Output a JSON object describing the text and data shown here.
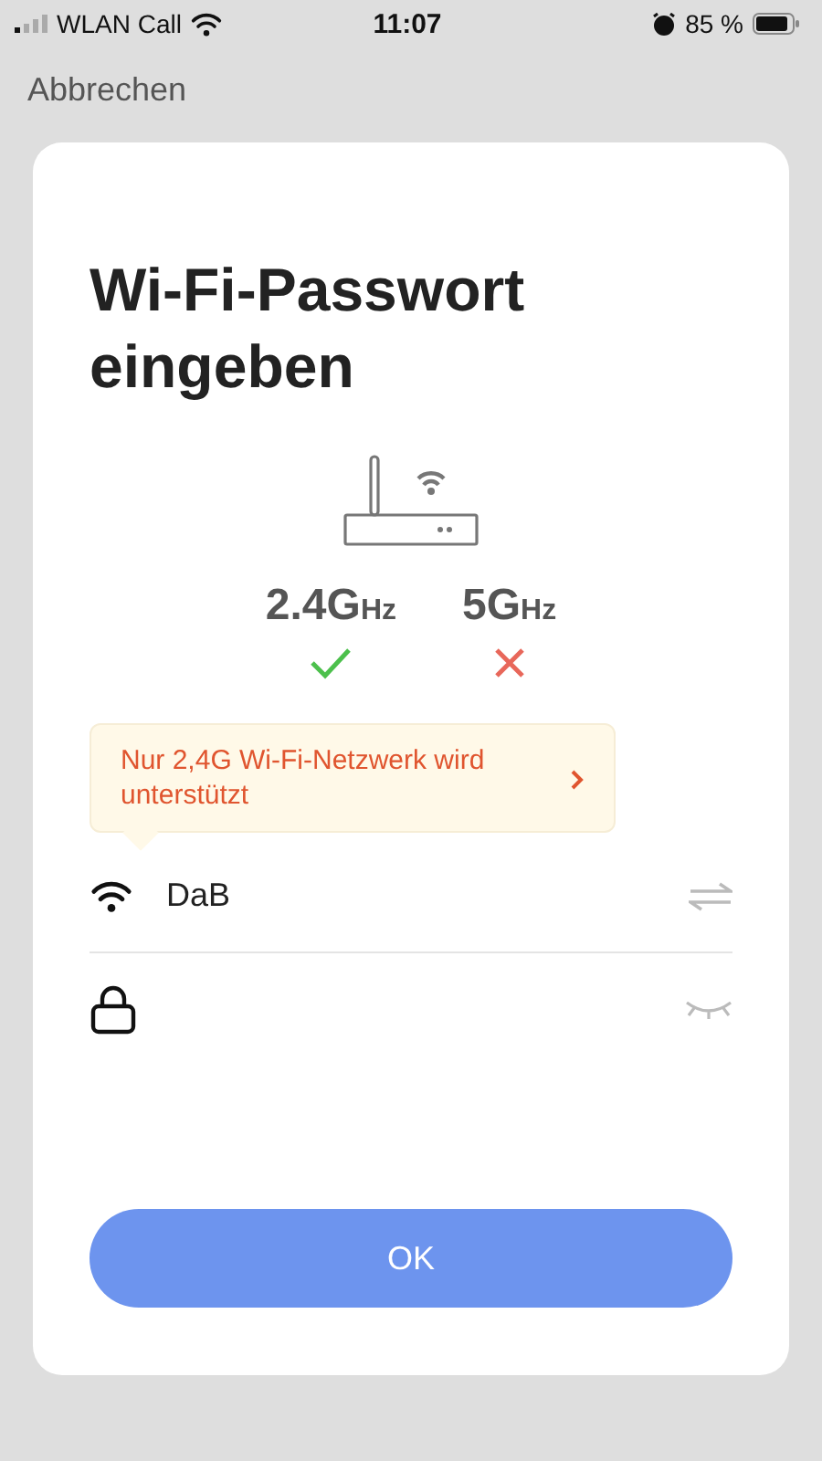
{
  "status_bar": {
    "carrier": "WLAN Call",
    "time": "11:07",
    "battery": "85 %"
  },
  "cancel": "Abbrechen",
  "title": "Wi-Fi-Passwort eingeben",
  "bands": [
    {
      "number": "2.4G",
      "unit": "Hz",
      "supported": true
    },
    {
      "number": "5G",
      "unit": "Hz",
      "supported": false
    }
  ],
  "notice": "Nur 2,4G Wi-Fi-Netzwerk wird unterstützt",
  "network_field": {
    "value": "DaB"
  },
  "ok_button": "OK"
}
